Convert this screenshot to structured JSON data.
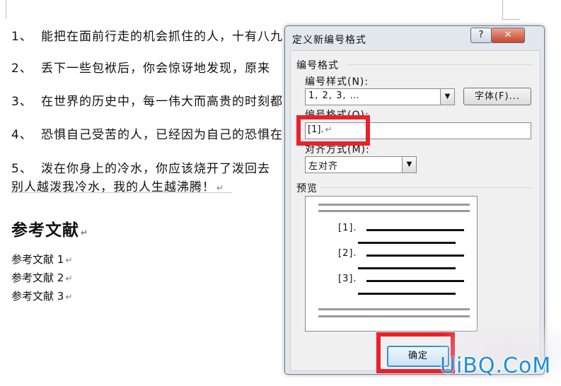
{
  "document": {
    "items": [
      {
        "num": "1、",
        "text": "能把在面前行走的机会抓住的人，十有八九"
      },
      {
        "num": "2、",
        "text": "丢下一些包袱后，你会惊讶地发现，原来"
      },
      {
        "num": "3、",
        "text": "在世界的历史中，每一伟大而高贵的时刻都"
      },
      {
        "num": "4、",
        "text": "恐惧自己受苦的人，已经因为自己的恐惧在"
      },
      {
        "num": "5、",
        "text": "泼在你身上的冷水，你应该烧开了泼回去"
      }
    ],
    "item5_cont": "别人越泼我冷水，我的人生越沸腾！",
    "heading": "参考文献",
    "references": [
      "参考文献 1",
      "参考文献 2",
      "参考文献 3"
    ],
    "para_mark": "↵"
  },
  "dialog": {
    "title": "定义新编号格式",
    "help_label": "?",
    "close_label": "✕",
    "group_label": "编号格式",
    "style_label": "编号样式(N):",
    "style_value": "1, 2, 3, …",
    "font_button": "字体(F)...",
    "format_label": "编号格式(O):",
    "format_value": "[1].",
    "format_cursor_char": "1",
    "align_label": "对齐方式(M):",
    "align_value": "左对齐",
    "preview_label": "预览",
    "preview_items": [
      "[1].",
      "[2].",
      "[3]."
    ],
    "ok_button": "确定"
  },
  "watermark": "UiBQ.CoM",
  "colors": {
    "highlight": "#e8212b",
    "watermark": "#1f8ed8",
    "dialog_bg": "#e3e8ef"
  }
}
